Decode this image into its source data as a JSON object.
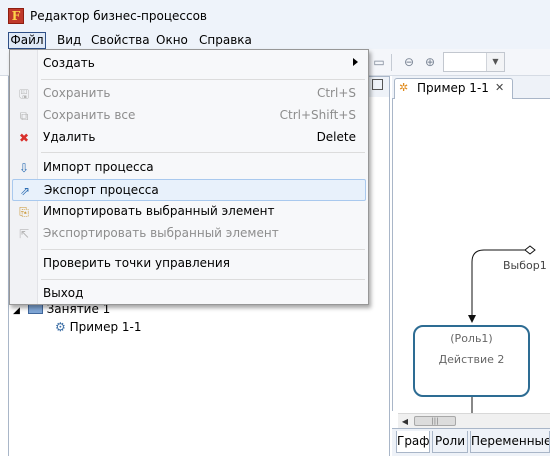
{
  "window": {
    "title": "Редактор бизнес-процессов"
  },
  "menubar": {
    "items": [
      "Файл",
      "Вид",
      "Свойства",
      "Окно",
      "Справка"
    ]
  },
  "file_menu": {
    "items": [
      {
        "label": "Создать",
        "shortcut": "",
        "icon": "none",
        "disabled": false,
        "submenu": true
      },
      {
        "label": "Сохранить",
        "shortcut": "Ctrl+S",
        "icon": "save-icon",
        "disabled": true
      },
      {
        "label": "Сохранить все",
        "shortcut": "Ctrl+Shift+S",
        "icon": "save-all-icon",
        "disabled": true
      },
      {
        "label": "Удалить",
        "shortcut": "Delete",
        "icon": "delete-icon",
        "disabled": false
      },
      {
        "label": "Импорт процесса",
        "shortcut": "",
        "icon": "import-icon",
        "disabled": false
      },
      {
        "label": "Экспорт процесса",
        "shortcut": "",
        "icon": "export-icon",
        "disabled": false,
        "highlighted": true
      },
      {
        "label": "Импортировать выбранный элемент",
        "shortcut": "",
        "icon": "import-element-icon",
        "disabled": false
      },
      {
        "label": "Экспортировать выбранный элемент",
        "shortcut": "",
        "icon": "export-element-icon",
        "disabled": true
      },
      {
        "label": "Проверить точки управления",
        "shortcut": "",
        "icon": "none",
        "disabled": false
      },
      {
        "label": "Выход",
        "shortcut": "",
        "icon": "none",
        "disabled": false
      }
    ]
  },
  "explorer": {
    "tree": [
      {
        "label": "Занятие 1",
        "icon": "folder-icon",
        "expanded": true
      },
      {
        "label": "Пример 1-1",
        "icon": "process-icon"
      }
    ]
  },
  "editor": {
    "tab_label": "Пример 1-1",
    "node": {
      "role": "(Роль1)",
      "action": "Действие 2"
    },
    "choice_label": "Выбор1",
    "bottom_tabs": [
      "Граф",
      "Роли",
      "Переменные"
    ]
  },
  "colors": {
    "accent": "#2d6c93",
    "menu_highlight": "#e8f1fb",
    "delete_red": "#d9302b"
  }
}
